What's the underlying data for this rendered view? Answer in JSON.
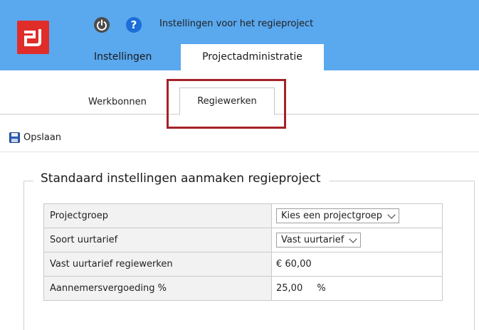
{
  "header": {
    "logo_text": "2J",
    "power_icon": "power-icon",
    "help_icon": "help-icon",
    "help_symbol": "?",
    "title": "Instellingen voor het regieproject",
    "tabs": [
      {
        "label": "Instellingen"
      },
      {
        "label": "Projectadministratie"
      }
    ],
    "colors": {
      "bar": "#5aa8ee",
      "logo": "#e12d2a"
    }
  },
  "subtabs": [
    {
      "label": "Werkbonnen"
    },
    {
      "label": "Regiewerken"
    }
  ],
  "toolbar": {
    "save_label": "Opslaan",
    "save_icon": "floppy-disk-icon"
  },
  "section": {
    "title": "Standaard instellingen aanmaken regieproject",
    "rows": [
      {
        "label": "Projectgroep",
        "value": "Kies een projectgroep",
        "type": "select"
      },
      {
        "label": "Soort uurtarief",
        "value": "Vast uurtarief",
        "type": "select"
      },
      {
        "label": "Vast uurtarief regiewerken",
        "value": "€ 60,00",
        "type": "text"
      },
      {
        "label": "Aannemersvergoeding %",
        "value": "25,00",
        "unit": "%",
        "type": "text"
      }
    ]
  },
  "highlight_color": "#a32228"
}
